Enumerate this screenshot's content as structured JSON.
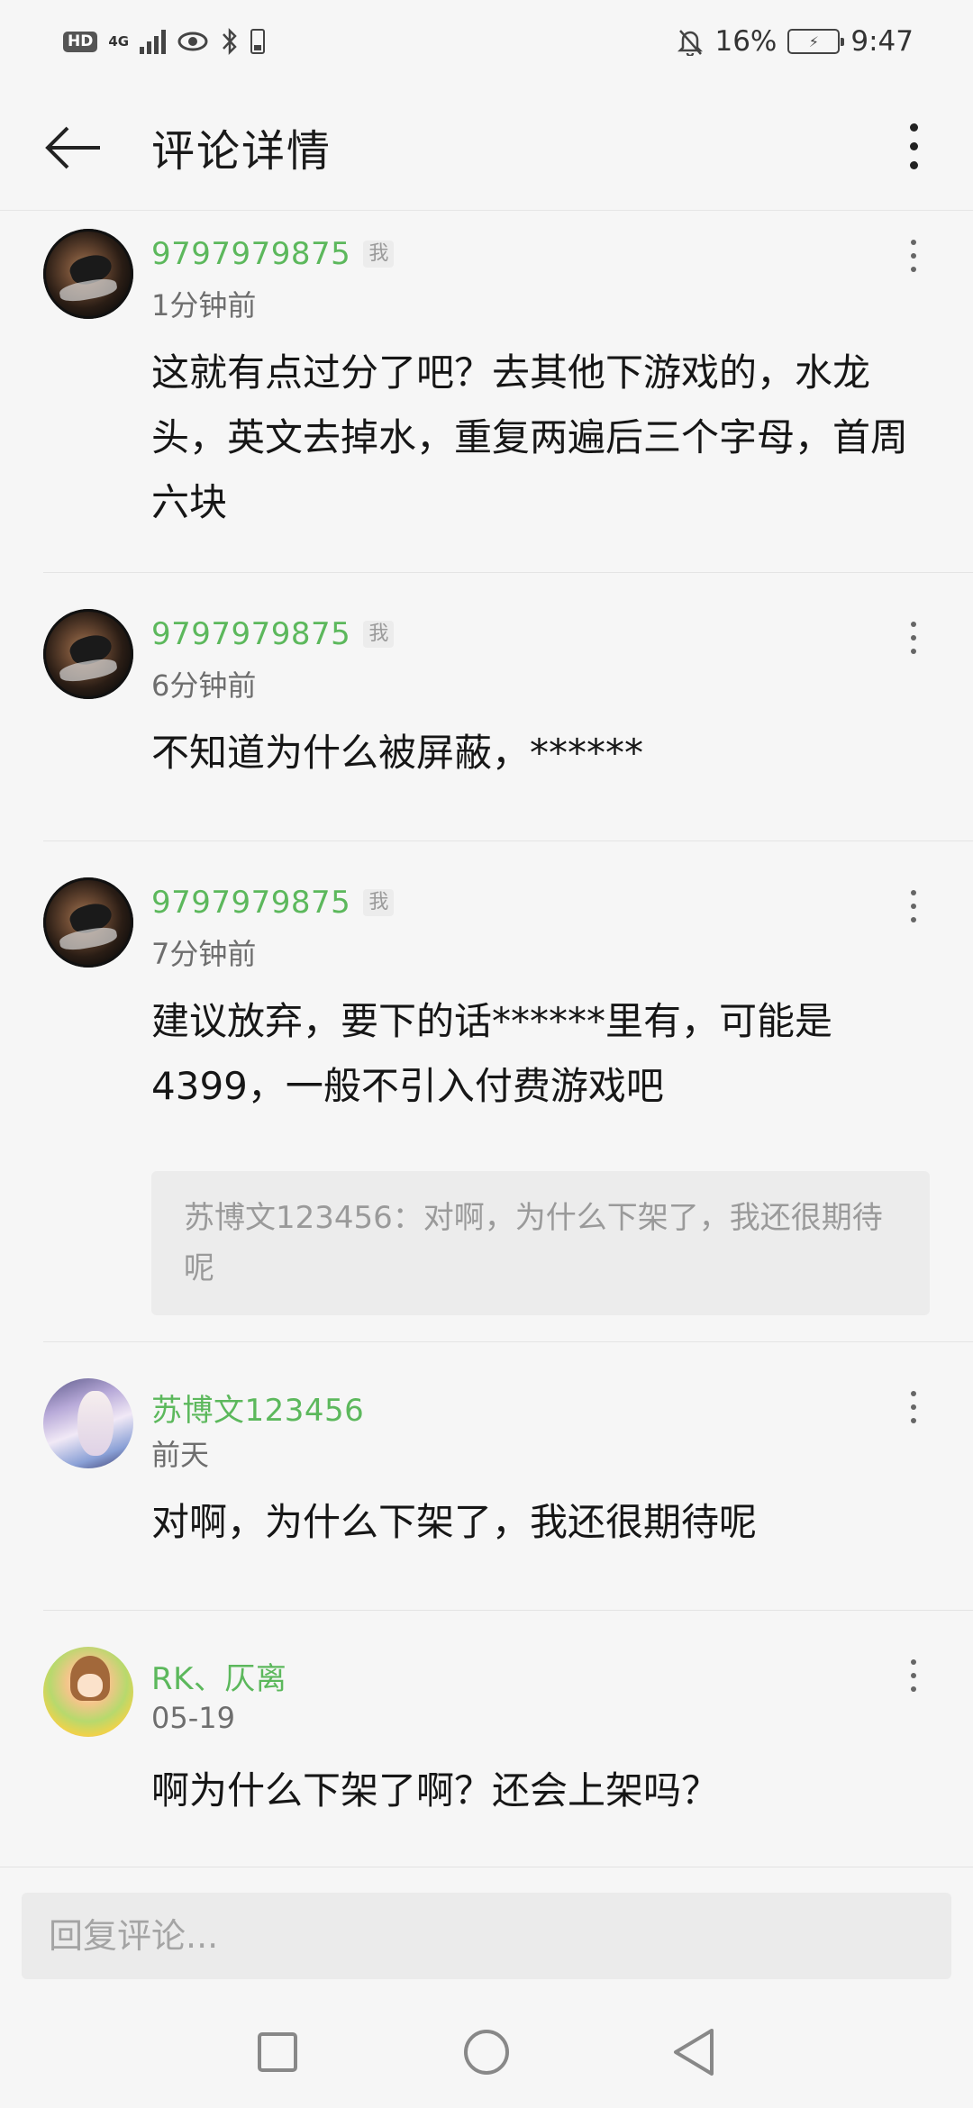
{
  "status_bar": {
    "hd": "HD",
    "network": "4G",
    "battery_percent": "16%",
    "time": "9:47"
  },
  "header": {
    "title": "评论详情"
  },
  "comments": [
    {
      "username": "9797979875",
      "badge": "我",
      "time": "1分钟前",
      "text": "这就有点过分了吧？去其他下游戏的，水龙头，英文去掉水，重复两遍后三个字母，首周六块",
      "quote": ""
    },
    {
      "username": "9797979875",
      "badge": "我",
      "time": "6分钟前",
      "text": "不知道为什么被屏蔽，******",
      "quote": ""
    },
    {
      "username": "9797979875",
      "badge": "我",
      "time": "7分钟前",
      "text": "建议放弃，要下的话******里有，可能是4399，一般不引入付费游戏吧",
      "quote": "苏博文123456：对啊，为什么下架了，我还很期待呢"
    },
    {
      "username": "苏博文123456",
      "badge": "",
      "time": "前天",
      "text": "对啊，为什么下架了，我还很期待呢",
      "quote": ""
    },
    {
      "username": "RK、仄离",
      "badge": "",
      "time": "05-19",
      "text": "啊为什么下架了啊？还会上架吗？",
      "quote": ""
    }
  ],
  "reply": {
    "placeholder": "回复评论..."
  },
  "colors": {
    "username": "#5cb85c",
    "background": "#f6f6f6"
  }
}
